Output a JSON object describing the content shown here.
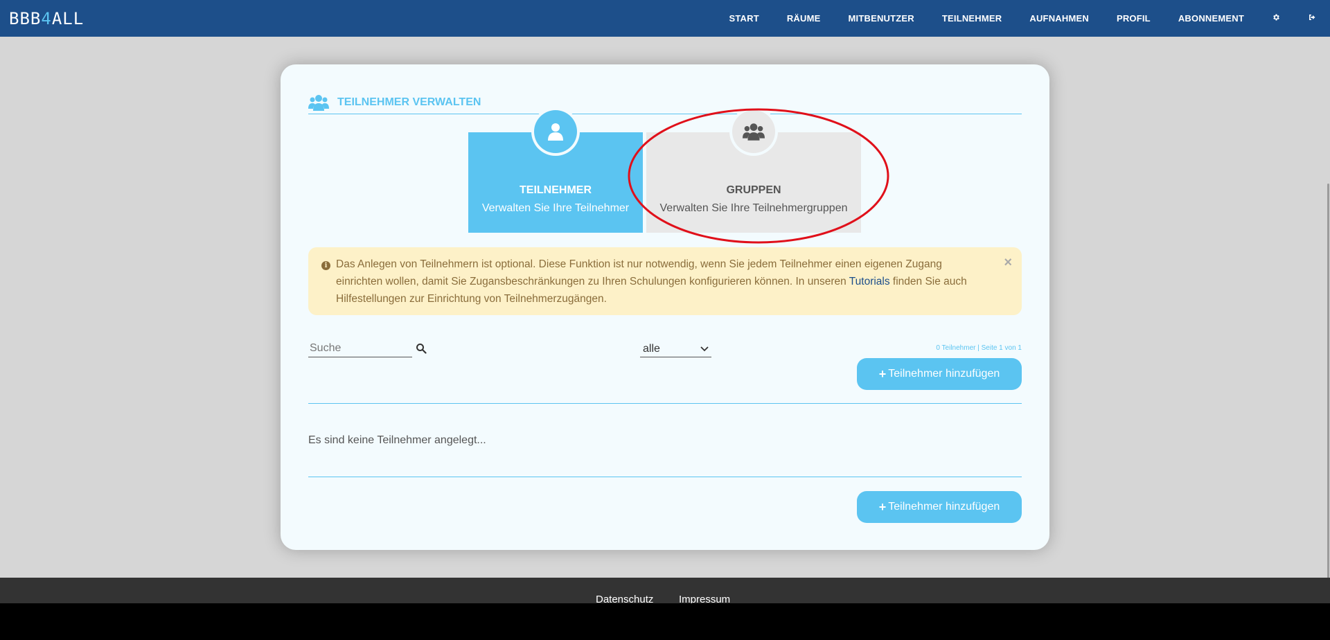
{
  "header": {
    "logo_left": "BBB",
    "logo_accent": "4",
    "logo_right": "ALL",
    "nav": [
      "START",
      "RÄUME",
      "MITBENUTZER",
      "TEILNEHMER",
      "AUFNAHMEN",
      "PROFIL",
      "ABONNEMENT"
    ],
    "icons": [
      "gear-icon",
      "logout-icon"
    ]
  },
  "card": {
    "title": "TEILNEHMER VERWALTEN",
    "tabs": [
      {
        "title": "TEILNEHMER",
        "subtitle": "Verwalten Sie Ihre Teilnehmer",
        "active": true,
        "icon": "user-icon"
      },
      {
        "title": "GRUPPEN",
        "subtitle": "Verwalten Sie Ihre Teilnehmergruppen",
        "active": false,
        "icon": "users-icon"
      }
    ],
    "alert": {
      "text_before": "Das Anlegen von Teilnehmern ist optional. Diese Funktion ist nur notwendig, wenn Sie jedem Teilnehmer einen eigenen Zugang einrichten wollen, damit Sie Zugansbeschränkungen zu Ihren Schulungen konfigurieren können. In unseren ",
      "link": "Tutorials",
      "text_after": " finden Sie auch Hilfestellungen zur Einrichtung von Teilnehmerzugängen.",
      "close": "×"
    },
    "search_placeholder": "Suche",
    "filter_value": "alle",
    "count_text": "0 Teilnehmer | Seite 1 von 1",
    "add_button": "Teilnehmer hinzufügen",
    "empty_text": "Es sind keine Teilnehmer angelegt..."
  },
  "footer": {
    "links": [
      "Datenschutz",
      "Impressum"
    ]
  },
  "colors": {
    "nav_bg": "#1d4f8a",
    "accent": "#5bc4f1",
    "alert_bg": "#fdf1c8",
    "highlight": "#e0101a"
  }
}
